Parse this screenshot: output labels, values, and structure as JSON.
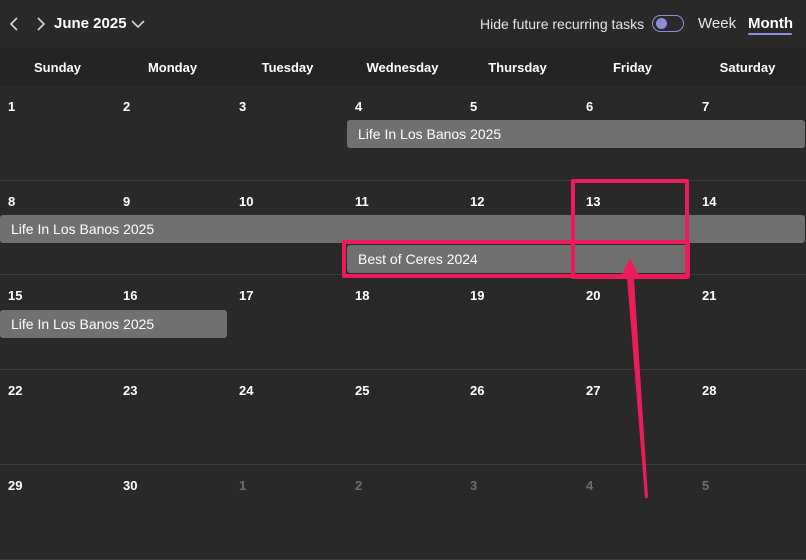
{
  "header": {
    "prev_icon": "chevron-left-icon",
    "next_icon": "chevron-right-icon",
    "month_title": "June 2025",
    "dropdown_icon": "chevron-down-icon",
    "toggle_label": "Hide future recurring tasks",
    "toggle_on": true,
    "view_week": "Week",
    "view_month": "Month"
  },
  "colors": {
    "accent": "#8c8fd8",
    "event": "#707070",
    "highlight": "#ec1c5a",
    "background": "#292929"
  },
  "day_headers": [
    "Sunday",
    "Monday",
    "Tuesday",
    "Wednesday",
    "Thursday",
    "Friday",
    "Saturday"
  ],
  "weeks": [
    {
      "dates": [
        "1",
        "2",
        "3",
        "4",
        "5",
        "6",
        "7"
      ],
      "events": [
        {
          "title": "Life In Los Banos 2025"
        }
      ]
    },
    {
      "dates": [
        "8",
        "9",
        "10",
        "11",
        "12",
        "13",
        "14"
      ],
      "events": [
        {
          "title": "Life In Los Banos 2025"
        },
        {
          "title": "Best of Ceres 2024"
        }
      ]
    },
    {
      "dates": [
        "15",
        "16",
        "17",
        "18",
        "19",
        "20",
        "21"
      ],
      "events": [
        {
          "title": "Life In Los Banos 2025"
        }
      ]
    },
    {
      "dates": [
        "22",
        "23",
        "24",
        "25",
        "26",
        "27",
        "28"
      ],
      "events": []
    },
    {
      "dates": [
        "29",
        "30",
        "1",
        "2",
        "3",
        "4",
        "5"
      ],
      "events": []
    }
  ]
}
